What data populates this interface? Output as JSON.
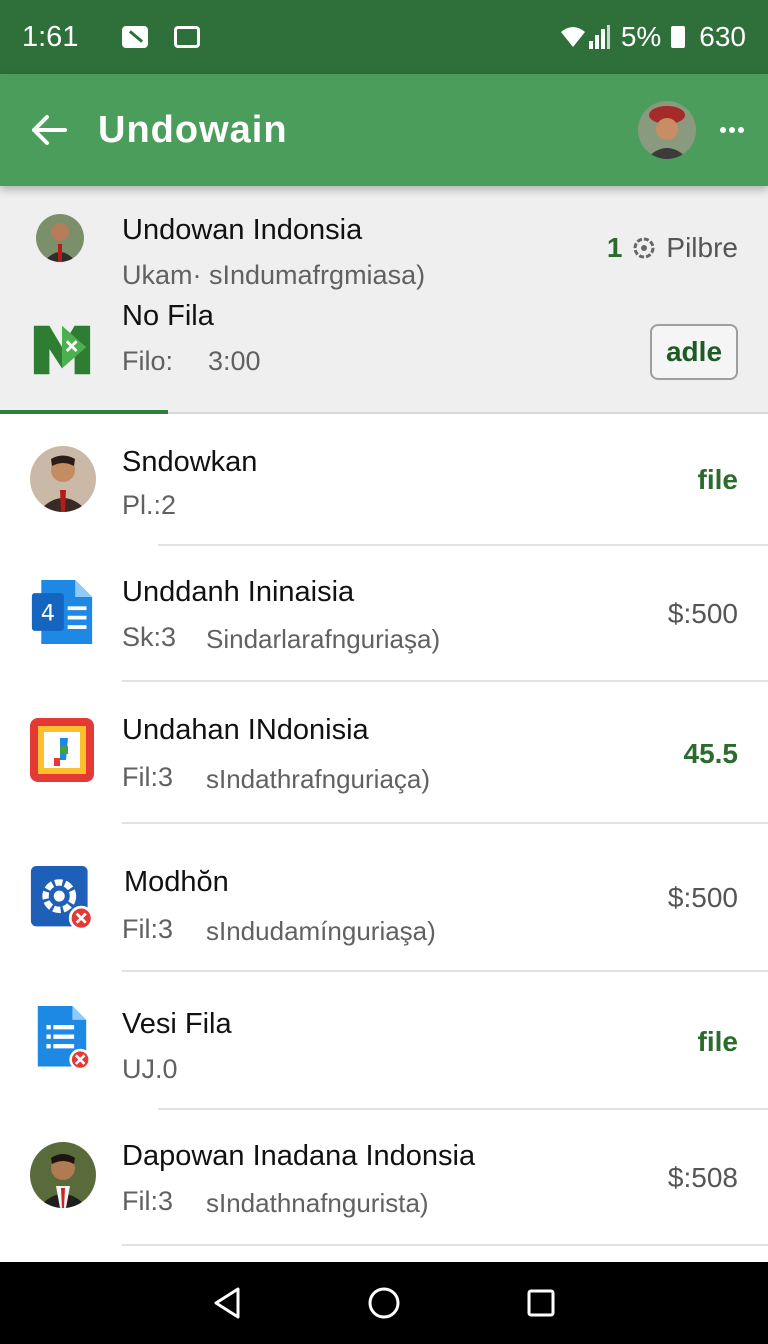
{
  "status_bar": {
    "time": "1:61",
    "battery": "5%",
    "extra": "630"
  },
  "app_bar": {
    "title": "Undowain"
  },
  "pinned": [
    {
      "title": "Undowan Indonsia",
      "subtitle": "Ukam· sIndumafrgmiasa)",
      "meta_count": "1",
      "meta_label": "Pilbre"
    },
    {
      "title": "No Fila",
      "subtitle_a": "Filo:",
      "subtitle_b": "3:00",
      "button": "adle"
    }
  ],
  "items": [
    {
      "title": "Sndowkan",
      "subtitle_a": "Pl.:2",
      "subtitle_b": "",
      "meta": "file",
      "meta_style": "green"
    },
    {
      "title": "Unddanh Ininaisia",
      "subtitle_a": "Sk:3",
      "subtitle_b": "Sindarlarafnguriaşa)",
      "meta": "$:500",
      "meta_style": "gray"
    },
    {
      "title": "Undahan INdonisia",
      "subtitle_a": "Fil:3",
      "subtitle_b": "sIndathrafnguriaça)",
      "meta": "45.5",
      "meta_style": "green"
    },
    {
      "title": "Modhŏn",
      "subtitle_a": "Fil:3",
      "subtitle_b": "sIndudamínguriaşa)",
      "meta": "$:500",
      "meta_style": "gray"
    },
    {
      "title": "Vesi Fila",
      "subtitle_a": "UJ.0",
      "subtitle_b": "",
      "meta": "file",
      "meta_style": "green"
    },
    {
      "title": "Dapowan Inadana Indonsia",
      "subtitle_a": "Fil:3",
      "subtitle_b": "sIndathnafnguristа)",
      "meta": "$:508",
      "meta_style": "gray"
    }
  ],
  "icons": {
    "back": "arrow-back-icon",
    "overflow": "more-horizontal-icon",
    "nav": [
      "nav-back-icon",
      "nav-home-icon",
      "nav-recents-icon"
    ]
  },
  "colors": {
    "status_bar": "#2e6f3a",
    "app_bar": "#4a9d5a",
    "accent_green": "#2b6b2e"
  }
}
